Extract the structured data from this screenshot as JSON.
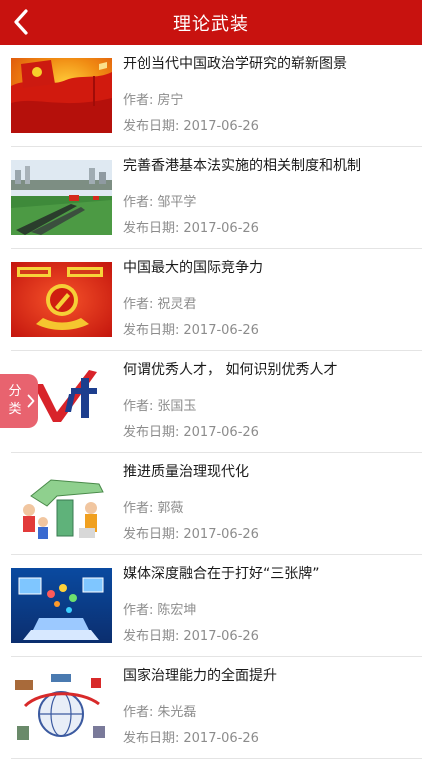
{
  "nav": {
    "title": "理论武装",
    "back_icon": "chevron-left-icon"
  },
  "colors": {
    "nav_bg": "#c8120f",
    "category_tab": "#e8636f",
    "meta_text": "#8c8c8c"
  },
  "labels": {
    "author": "作者:",
    "date": "发布日期:"
  },
  "category_tab": {
    "label": "分类",
    "icon": "chevron-right-icon"
  },
  "articles": [
    {
      "title": "开创当代中国政治学研究的崭新图景",
      "author": "房宁",
      "date": "2017-06-26",
      "thumbnail": "red-flag-image"
    },
    {
      "title": "完善香港基本法实施的相关制度和机制",
      "author": "邹平学",
      "date": "2017-06-26",
      "thumbnail": "hong-kong-parade-image"
    },
    {
      "title": "中国最大的国际竞争力",
      "author": "祝灵君",
      "date": "2017-06-26",
      "thumbnail": "party-emblem-image"
    },
    {
      "title": "何谓优秀人才， 如何识别优秀人才",
      "author": "张国玉",
      "date": "2017-06-26",
      "thumbnail": "talent-checkmark-image"
    },
    {
      "title": "推进质量治理现代化",
      "author": "郭薇",
      "date": "2017-06-26",
      "thumbnail": "quality-cartoon-image"
    },
    {
      "title": "媒体深度融合在于打好“三张牌”",
      "author": "陈宏坤",
      "date": "2017-06-26",
      "thumbnail": "media-devices-image"
    },
    {
      "title": "国家治理能力的全面提升",
      "author": "朱光磊",
      "date": "2017-06-26",
      "thumbnail": "governance-globe-image"
    }
  ]
}
